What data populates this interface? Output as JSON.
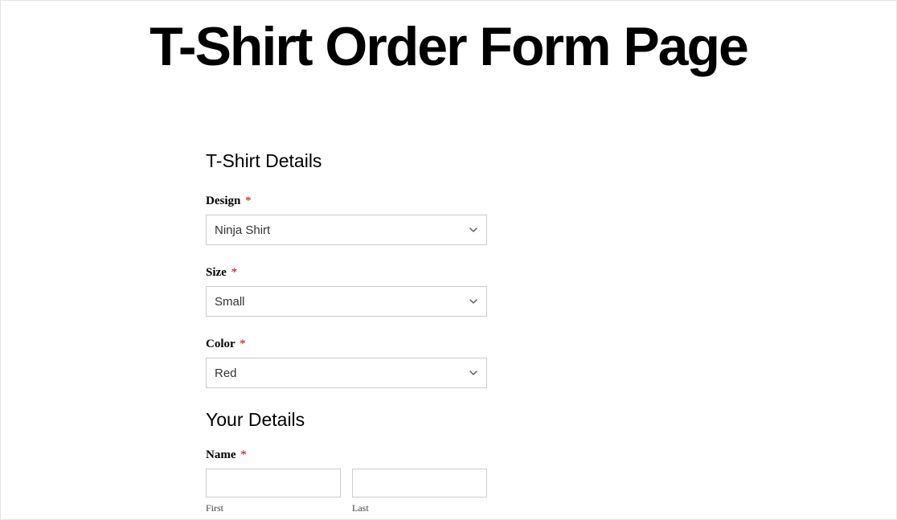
{
  "header": {
    "title": "T-Shirt Order Form Page"
  },
  "sections": {
    "tshirt": {
      "heading": "T-Shirt Details"
    },
    "your": {
      "heading": "Your Details"
    }
  },
  "fields": {
    "design": {
      "label": "Design",
      "required": "*",
      "value": "Ninja Shirt"
    },
    "size": {
      "label": "Size",
      "required": "*",
      "value": "Small"
    },
    "color": {
      "label": "Color",
      "required": "*",
      "value": "Red"
    },
    "name": {
      "label": "Name",
      "required": "*",
      "first_sublabel": "First",
      "last_sublabel": "Last"
    }
  }
}
